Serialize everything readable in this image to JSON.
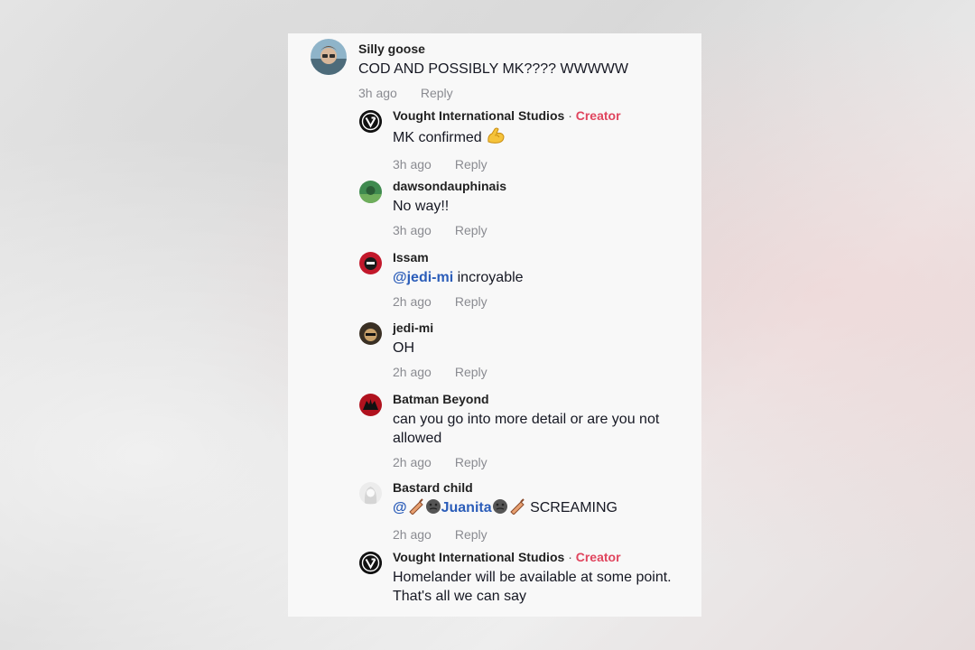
{
  "comments": [
    {
      "author": "Silly goose",
      "text": "COD AND POSSIBLY MK???? WWWWW",
      "time": "3h ago",
      "reply_label": "Reply"
    }
  ],
  "replies": [
    {
      "author": "Vought International Studios",
      "separator": "·",
      "badge": "Creator",
      "text": "MK confirmed",
      "emoji": "flexed-biceps-icon",
      "time": "3h ago",
      "reply_label": "Reply"
    },
    {
      "author": "dawsondauphinais",
      "text": "No way!!",
      "time": "3h ago",
      "reply_label": "Reply"
    },
    {
      "author": "Issam",
      "mention": "@jedi-mi",
      "text": " incroyable",
      "time": "2h ago",
      "reply_label": "Reply"
    },
    {
      "author": "jedi-mi",
      "text": "OH",
      "time": "2h ago",
      "reply_label": "Reply"
    },
    {
      "author": "Batman Beyond",
      "text": "can you go into more detail or are you not allowed",
      "time": "2h ago",
      "reply_label": "Reply"
    },
    {
      "author": "Bastard child",
      "mention_at": "@",
      "mention_name": "Juanita",
      "text": " SCREAMING",
      "time": "2h ago",
      "reply_label": "Reply"
    },
    {
      "author": "Vought International Studios",
      "separator": "·",
      "badge": "Creator",
      "text": "Homelander will be available at some point. That's all we can say"
    }
  ],
  "colors": {
    "creator_badge": "#e0455e",
    "mention": "#2b5db9",
    "meta": "#8a8b91"
  }
}
